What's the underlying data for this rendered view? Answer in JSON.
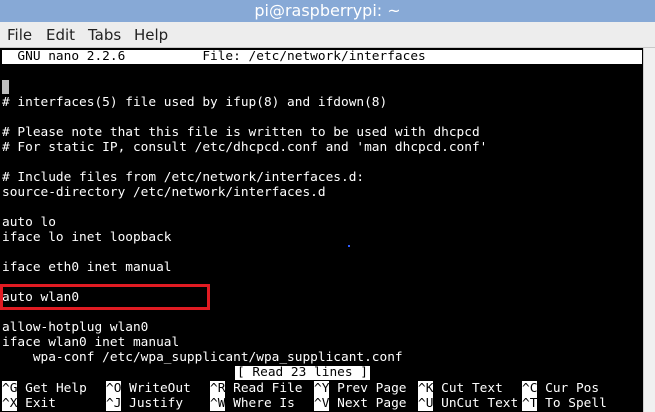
{
  "window": {
    "title": "pi@raspberrypi: ~"
  },
  "menu": [
    {
      "name": "menu-file",
      "label": "File"
    },
    {
      "name": "menu-edit",
      "label": "Edit"
    },
    {
      "name": "menu-tabs",
      "label": "Tabs"
    },
    {
      "name": "menu-help",
      "label": "Help"
    }
  ],
  "nano": {
    "header": "  GNU nano 2.2.6          File: /etc/network/interfaces",
    "lines": [
      "# interfaces(5) file used by ifup(8) and ifdown(8)",
      "",
      "# Please note that this file is written to be used with dhcpcd",
      "# For static IP, consult /etc/dhcpcd.conf and 'man dhcpcd.conf'",
      "",
      "# Include files from /etc/network/interfaces.d:",
      "source-directory /etc/network/interfaces.d",
      "",
      "auto lo",
      "iface lo inet loopback",
      "",
      "iface eth0 inet manual",
      "",
      "auto wlan0",
      "",
      "allow-hotplug wlan0",
      "iface wlan0 inet manual",
      "    wpa-conf /etc/wpa_supplicant/wpa_supplicant.conf"
    ],
    "status": "[ Read 23 lines ]",
    "shortcuts_row1": [
      {
        "key": "^G",
        "label": "Get Help"
      },
      {
        "key": "^O",
        "label": "WriteOut"
      },
      {
        "key": "^R",
        "label": "Read File"
      },
      {
        "key": "^Y",
        "label": "Prev Page"
      },
      {
        "key": "^K",
        "label": "Cut Text"
      },
      {
        "key": "^C",
        "label": "Cur Pos"
      }
    ],
    "shortcuts_row2": [
      {
        "key": "^X",
        "label": "Exit"
      },
      {
        "key": "^J",
        "label": "Justify"
      },
      {
        "key": "^W",
        "label": "Where Is"
      },
      {
        "key": "^V",
        "label": "Next Page"
      },
      {
        "key": "^U",
        "label": "UnCut Text"
      },
      {
        "key": "^T",
        "label": "To Spell"
      }
    ]
  }
}
